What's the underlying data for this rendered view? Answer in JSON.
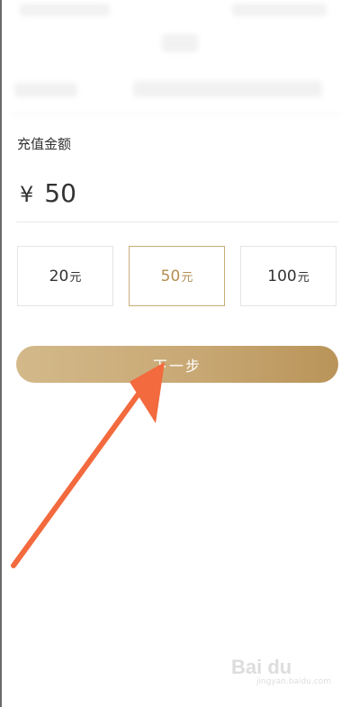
{
  "recharge": {
    "section_title": "充值金额",
    "currency_symbol": "¥",
    "amount_value": "50"
  },
  "options": [
    {
      "amount": "20",
      "unit": "元",
      "selected": false
    },
    {
      "amount": "50",
      "unit": "元",
      "selected": true
    },
    {
      "amount": "100",
      "unit": "元",
      "selected": false
    }
  ],
  "next_button": {
    "label": "下一步"
  },
  "colors": {
    "accent": "#c8a874",
    "selected_text": "#b48e52",
    "annotation_arrow": "#f26a3d"
  },
  "watermark": {
    "logo": "Bai du",
    "sub": "jingyan.baidu.com"
  }
}
